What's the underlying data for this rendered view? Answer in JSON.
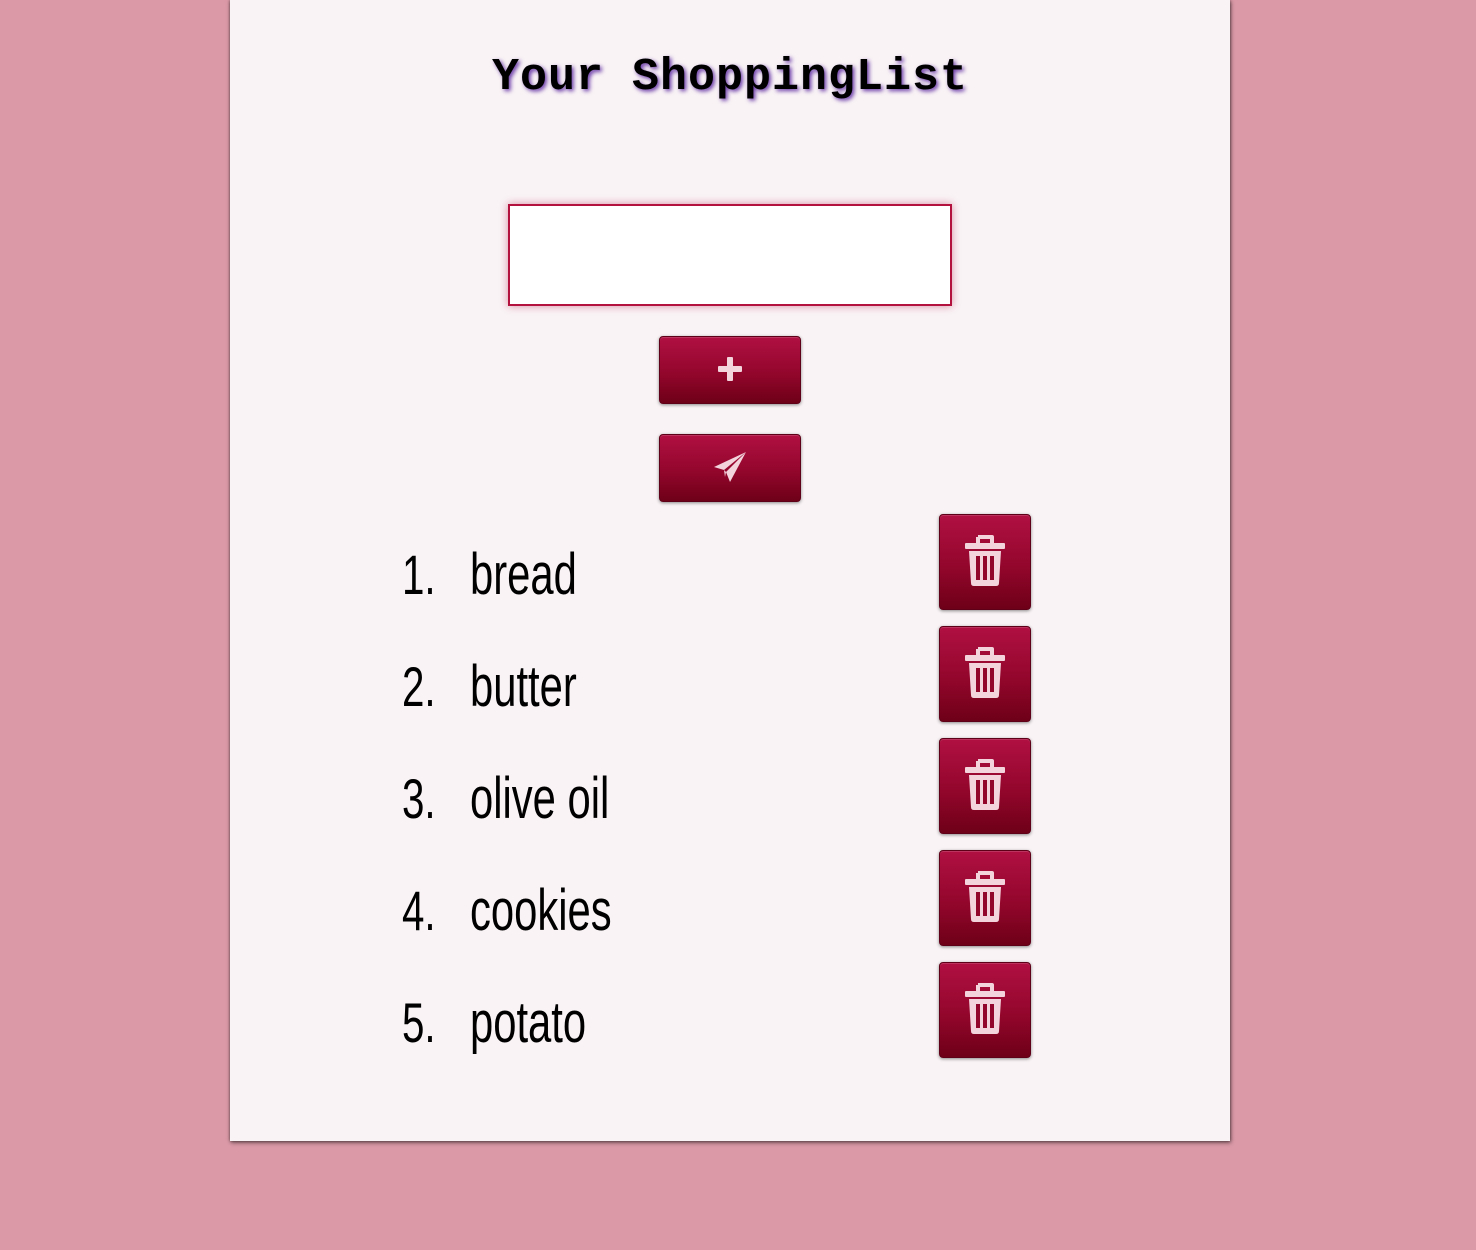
{
  "header": {
    "title": "Your ShoppingList"
  },
  "form": {
    "input_value": "",
    "input_placeholder": "",
    "add_icon": "plus-icon",
    "send_icon": "paper-plane-icon"
  },
  "list": {
    "delete_icon": "trash-icon",
    "items": [
      {
        "num": "1.",
        "label": "bread"
      },
      {
        "num": "2.",
        "label": "butter"
      },
      {
        "num": "3.",
        "label": "olive oil"
      },
      {
        "num": "4.",
        "label": "cookies"
      },
      {
        "num": "5.",
        "label": "potato"
      }
    ]
  },
  "colors": {
    "background": "#db99a7",
    "card": "#f9f3f5",
    "accent": "#93062c",
    "input_border": "#b3123f",
    "icon": "#f3d3dc"
  }
}
